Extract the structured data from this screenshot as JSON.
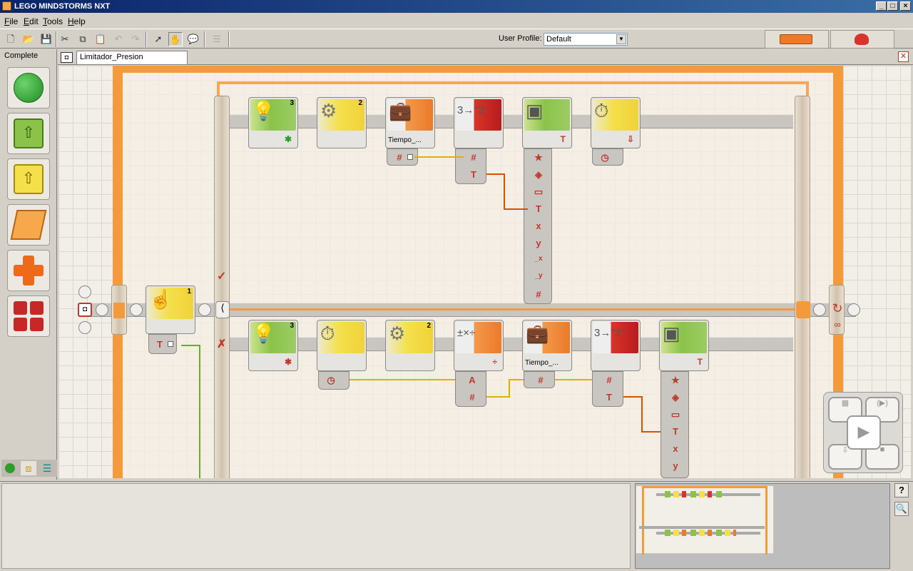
{
  "window": {
    "title": "LEGO MINDSTORMS NXT",
    "min": "_",
    "max": "□",
    "close": "×"
  },
  "menu": [
    {
      "label": "File",
      "key": "F"
    },
    {
      "label": "Edit",
      "key": "E"
    },
    {
      "label": "Tools",
      "key": "T"
    },
    {
      "label": "Help",
      "key": "H"
    }
  ],
  "toolbar": {
    "user_profile_label": "User Profile:",
    "user_profile_value": "Default"
  },
  "palette": {
    "label": "Complete"
  },
  "document": {
    "tab_title": "Limitador_Presion"
  },
  "canvas": {
    "switch_true_mark": "✓",
    "switch_false_mark": "✗",
    "loop_mark": "∞",
    "upper_blocks": [
      {
        "kind": "color-sensor",
        "port": "3"
      },
      {
        "kind": "rotation-sensor",
        "port": "2"
      },
      {
        "kind": "variable",
        "label": "Tiempo_..."
      },
      {
        "kind": "number-to-text"
      },
      {
        "kind": "display"
      },
      {
        "kind": "timer"
      }
    ],
    "lower_blocks": [
      {
        "kind": "color-sensor",
        "port": "3"
      },
      {
        "kind": "timer"
      },
      {
        "kind": "rotation-sensor",
        "port": "2"
      },
      {
        "kind": "math"
      },
      {
        "kind": "variable",
        "label": "Tiempo_..."
      },
      {
        "kind": "number-to-text"
      },
      {
        "kind": "display"
      }
    ],
    "switch_block_port": "1",
    "display_plugs": [
      "★",
      "◈",
      "▭",
      "T",
      "x",
      "y",
      "_x",
      "_y",
      "#"
    ]
  },
  "colors": {
    "loop": "#f39a3c",
    "sensor": "#f4e04a",
    "action": "#8bc34a",
    "data": "#ec7a2a",
    "advanced": "#d9342b"
  }
}
